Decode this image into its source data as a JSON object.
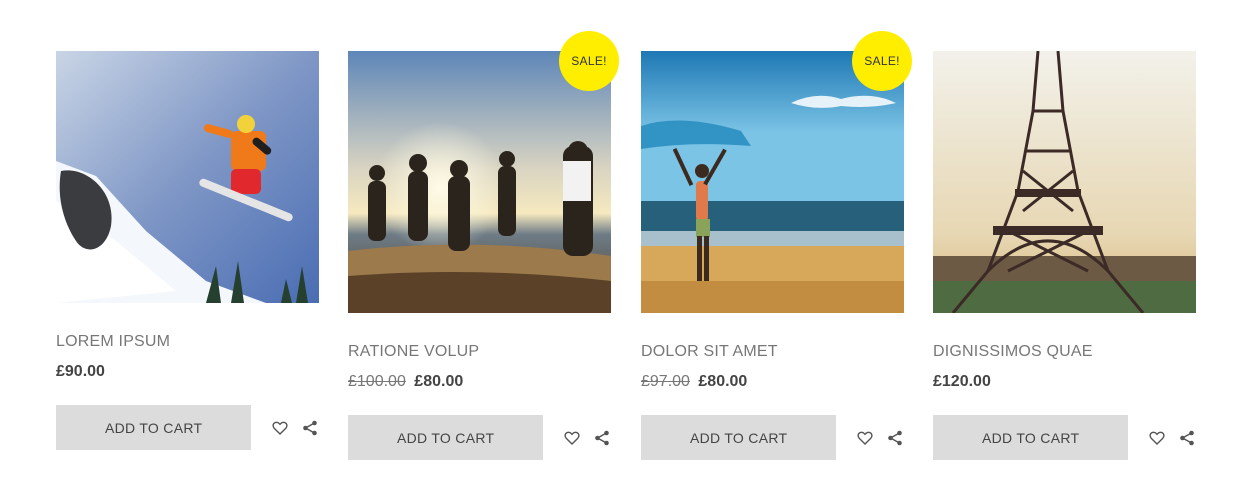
{
  "products": [
    {
      "title": "LOREM IPSUM",
      "price": "£90.00",
      "old_price": "",
      "sale_badge": "",
      "cart_label": "ADD TO CART",
      "image": "snowboarder jumping"
    },
    {
      "title": "RATIONE VOLUP",
      "price": "£80.00",
      "old_price": "£100.00",
      "sale_badge": "SALE!",
      "cart_label": "ADD TO CART",
      "image": "friends running on beach at sunset"
    },
    {
      "title": "DOLOR SIT AMET",
      "price": "£80.00",
      "old_price": "£97.00",
      "sale_badge": "SALE!",
      "cart_label": "ADD TO CART",
      "image": "woman holding scarf on beach"
    },
    {
      "title": "DIGNISSIMOS QUAE",
      "price": "£120.00",
      "old_price": "",
      "sale_badge": "",
      "cart_label": "ADD TO CART",
      "image": "eiffel tower"
    }
  ],
  "icons": {
    "wishlist": "heart-icon",
    "share": "share-icon"
  },
  "colors": {
    "sale_badge": "#ffee00",
    "button_bg": "#dcdcdc",
    "title_text": "#777777",
    "price_text": "#444444"
  }
}
